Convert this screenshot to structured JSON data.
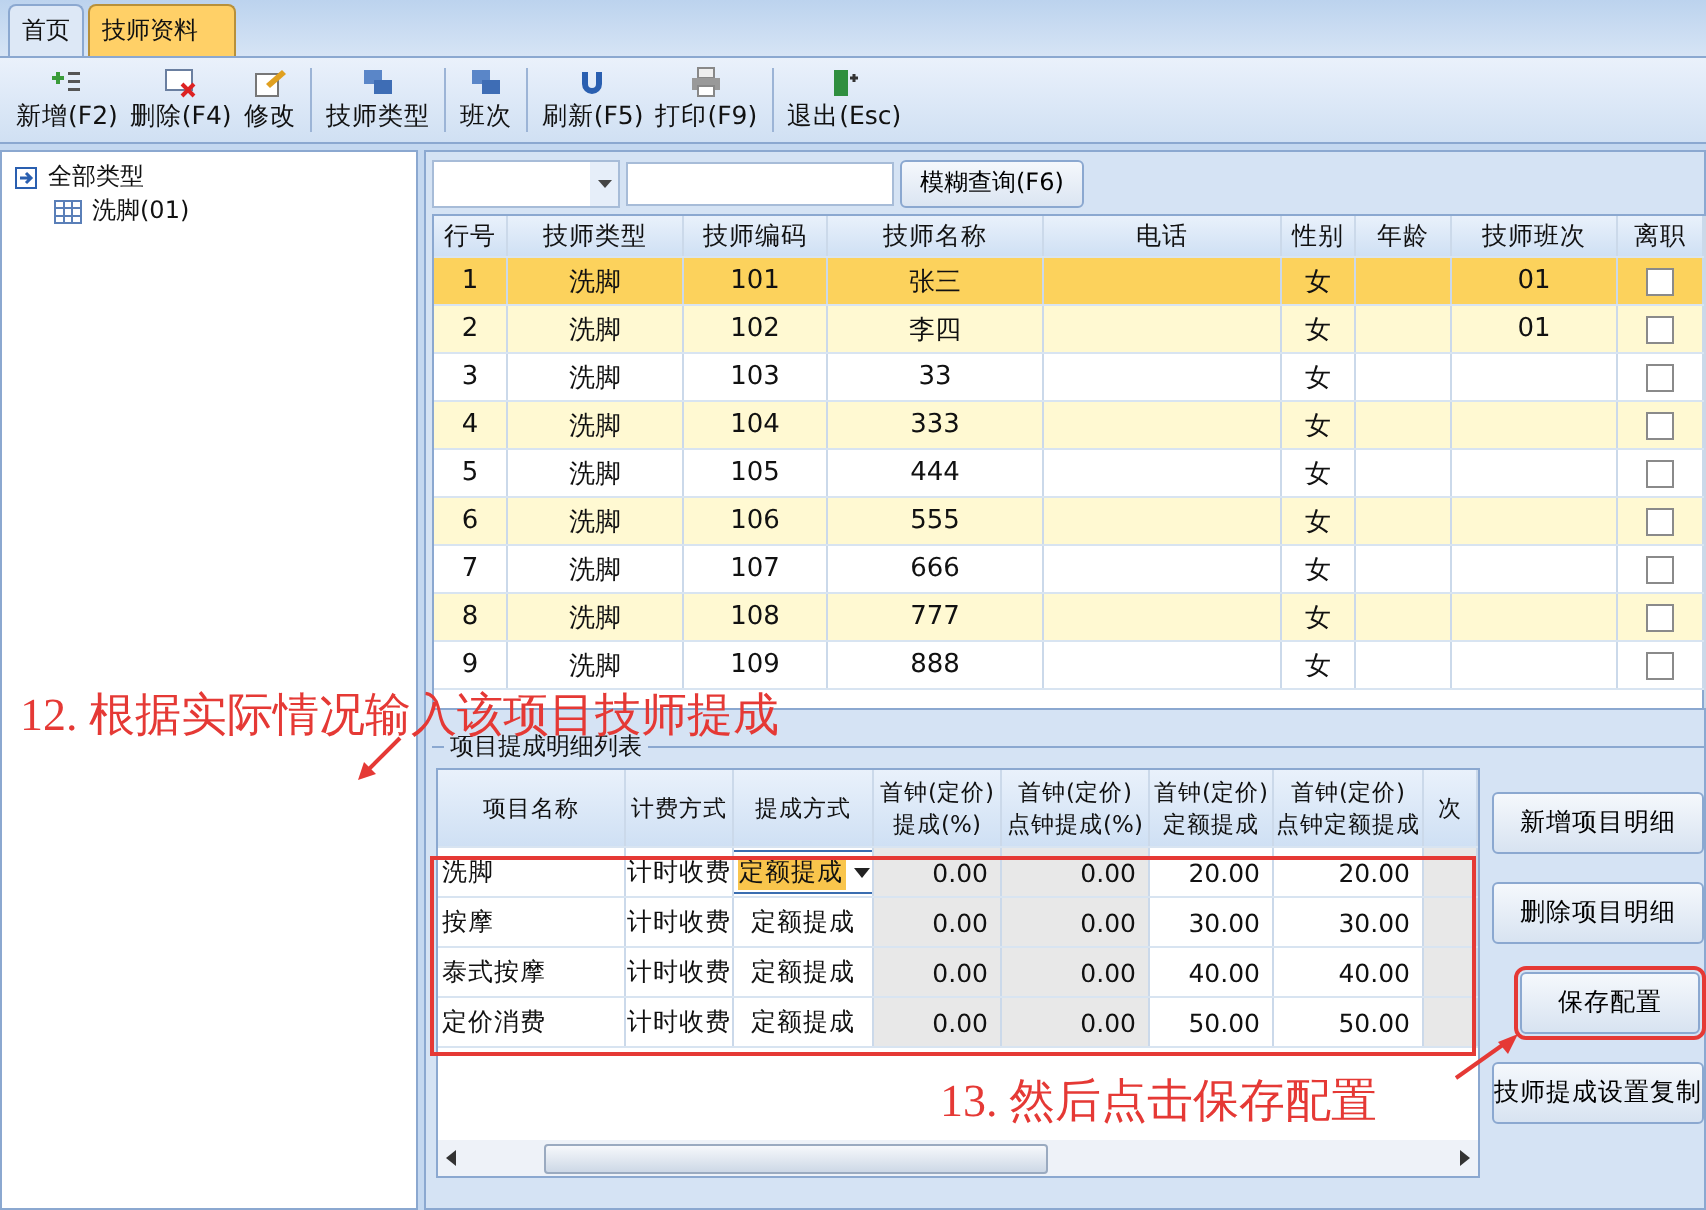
{
  "tabs": [
    {
      "label": "首页",
      "selected": false
    },
    {
      "label": "技师资料",
      "selected": true
    }
  ],
  "toolbar": [
    {
      "label": "新增(F2)"
    },
    {
      "label": "删除(F4)"
    },
    {
      "label": "修改"
    },
    {
      "label": "技师类型"
    },
    {
      "label": "班次"
    },
    {
      "label": "刷新(F5)"
    },
    {
      "label": "打印(F9)"
    },
    {
      "label": "退出(Esc)"
    }
  ],
  "tree": {
    "label": "全部类型",
    "children": [
      {
        "label": "洗脚(01)"
      }
    ]
  },
  "search": {
    "button": "模糊查询(F6)"
  },
  "grid": {
    "columns": [
      "行号",
      "技师类型",
      "技师编码",
      "技师名称",
      "电话",
      "性别",
      "年龄",
      "技师班次",
      "离职"
    ],
    "rows": [
      {
        "cells": [
          "1",
          "洗脚",
          "101",
          "张三",
          "",
          "女",
          "",
          "01"
        ],
        "resigned": false,
        "selected": true
      },
      {
        "cells": [
          "2",
          "洗脚",
          "102",
          "李四",
          "",
          "女",
          "",
          "01"
        ],
        "resigned": false,
        "selected": false
      },
      {
        "cells": [
          "3",
          "洗脚",
          "103",
          "33",
          "",
          "女",
          "",
          ""
        ],
        "resigned": false,
        "selected": false
      },
      {
        "cells": [
          "4",
          "洗脚",
          "104",
          "333",
          "",
          "女",
          "",
          ""
        ],
        "resigned": false,
        "selected": false
      },
      {
        "cells": [
          "5",
          "洗脚",
          "105",
          "444",
          "",
          "女",
          "",
          ""
        ],
        "resigned": false,
        "selected": false
      },
      {
        "cells": [
          "6",
          "洗脚",
          "106",
          "555",
          "",
          "女",
          "",
          ""
        ],
        "resigned": false,
        "selected": false
      },
      {
        "cells": [
          "7",
          "洗脚",
          "107",
          "666",
          "",
          "女",
          "",
          ""
        ],
        "resigned": false,
        "selected": false
      },
      {
        "cells": [
          "8",
          "洗脚",
          "108",
          "777",
          "",
          "女",
          "",
          ""
        ],
        "resigned": false,
        "selected": false
      },
      {
        "cells": [
          "9",
          "洗脚",
          "109",
          "888",
          "",
          "女",
          "",
          ""
        ],
        "resigned": false,
        "selected": false
      }
    ]
  },
  "detail": {
    "title": "项目提成明细列表",
    "columns": [
      "项目名称",
      "计费方式",
      "提成方式",
      "首钟(定价) 提成(%)",
      "首钟(定价) 点钟提成(%)",
      "首钟(定价) 定额提成",
      "首钟(定价) 点钟定额提成",
      "次"
    ],
    "rows": [
      {
        "cells": [
          "洗脚",
          "计时收费",
          "定额提成",
          "0.00",
          "0.00",
          "20.00",
          "20.00",
          ""
        ],
        "editing": true
      },
      {
        "cells": [
          "按摩",
          "计时收费",
          "定额提成",
          "0.00",
          "0.00",
          "30.00",
          "30.00",
          ""
        ]
      },
      {
        "cells": [
          "泰式按摩",
          "计时收费",
          "定额提成",
          "0.00",
          "0.00",
          "40.00",
          "40.00",
          ""
        ]
      },
      {
        "cells": [
          "定价消费",
          "计时收费",
          "定额提成",
          "0.00",
          "0.00",
          "50.00",
          "50.00",
          ""
        ]
      }
    ],
    "buttons": [
      {
        "label": "新增项目明细",
        "highlighted": false
      },
      {
        "label": "删除项目明细",
        "highlighted": false
      },
      {
        "label": "保存配置",
        "highlighted": true
      },
      {
        "label": "技师提成设置复制",
        "highlighted": false
      }
    ]
  },
  "annotations": [
    {
      "text": "12. 根据实际情况输入该项目技师提成"
    },
    {
      "text": "13. 然后点击保存配置"
    }
  ]
}
